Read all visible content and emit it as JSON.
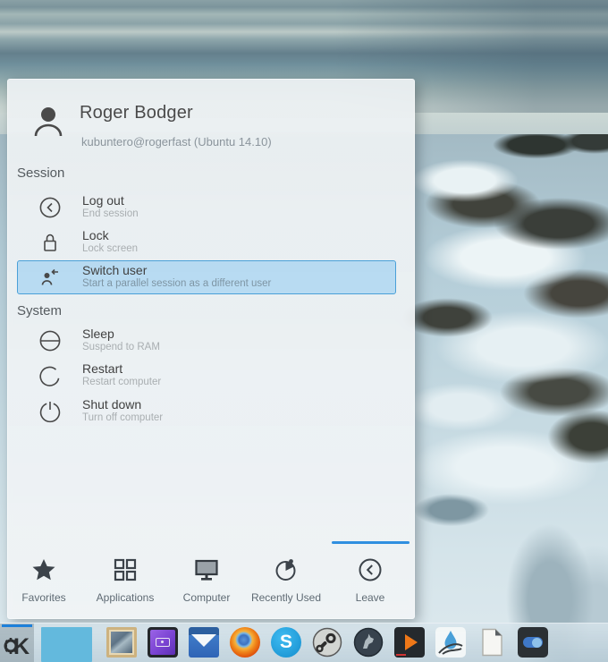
{
  "launcher": {
    "user": {
      "name": "Roger Bodger",
      "detail": "kubuntero@rogerfast (Ubuntu 14.10)",
      "avatar_icon": "user-avatar-icon"
    },
    "sections": [
      {
        "label": "Session",
        "items": [
          {
            "title": "Log out",
            "subtitle": "End session",
            "icon": "logout-icon",
            "highlighted": false
          },
          {
            "title": "Lock",
            "subtitle": "Lock screen",
            "icon": "lock-icon",
            "highlighted": false
          },
          {
            "title": "Switch user",
            "subtitle": "Start a parallel session as a different user",
            "icon": "switch-user-icon",
            "highlighted": true
          }
        ]
      },
      {
        "label": "System",
        "items": [
          {
            "title": "Sleep",
            "subtitle": "Suspend to RAM",
            "icon": "sleep-icon",
            "highlighted": false
          },
          {
            "title": "Restart",
            "subtitle": "Restart computer",
            "icon": "restart-icon",
            "highlighted": false
          },
          {
            "title": "Shut down",
            "subtitle": "Turn off computer",
            "icon": "shutdown-icon",
            "highlighted": false
          }
        ]
      }
    ],
    "tabs": [
      {
        "label": "Favorites",
        "icon": "favorites-star-icon",
        "active": false
      },
      {
        "label": "Applications",
        "icon": "applications-grid-icon",
        "active": false
      },
      {
        "label": "Computer",
        "icon": "computer-monitor-icon",
        "active": false
      },
      {
        "label": "Recently Used",
        "icon": "recently-used-clock-icon",
        "active": false
      },
      {
        "label": "Leave",
        "icon": "leave-icon",
        "active": true
      }
    ]
  },
  "taskbar": {
    "launcher_button": {
      "icon": "kde-launcher-icon",
      "letter": "K",
      "active": true
    },
    "apps": [
      {
        "icon": "image-viewer-icon"
      },
      {
        "icon": "video-app-icon"
      },
      {
        "icon": "mail-app-icon"
      },
      {
        "icon": "firefox-icon"
      },
      {
        "icon": "skype-icon",
        "letter": "S"
      },
      {
        "icon": "steam-icon"
      },
      {
        "icon": "amarok-icon"
      },
      {
        "icon": "media-player-icon"
      },
      {
        "icon": "quill-app-icon"
      },
      {
        "icon": "documents-app-icon"
      },
      {
        "icon": "toggle-app-icon"
      }
    ]
  },
  "colors": {
    "accent_blue": "#2f8fe0",
    "highlight_fill": "rgba(122,194,239,0.45)",
    "highlight_border": "#4aa0d8",
    "launcher_indicator": "#1d80da"
  }
}
